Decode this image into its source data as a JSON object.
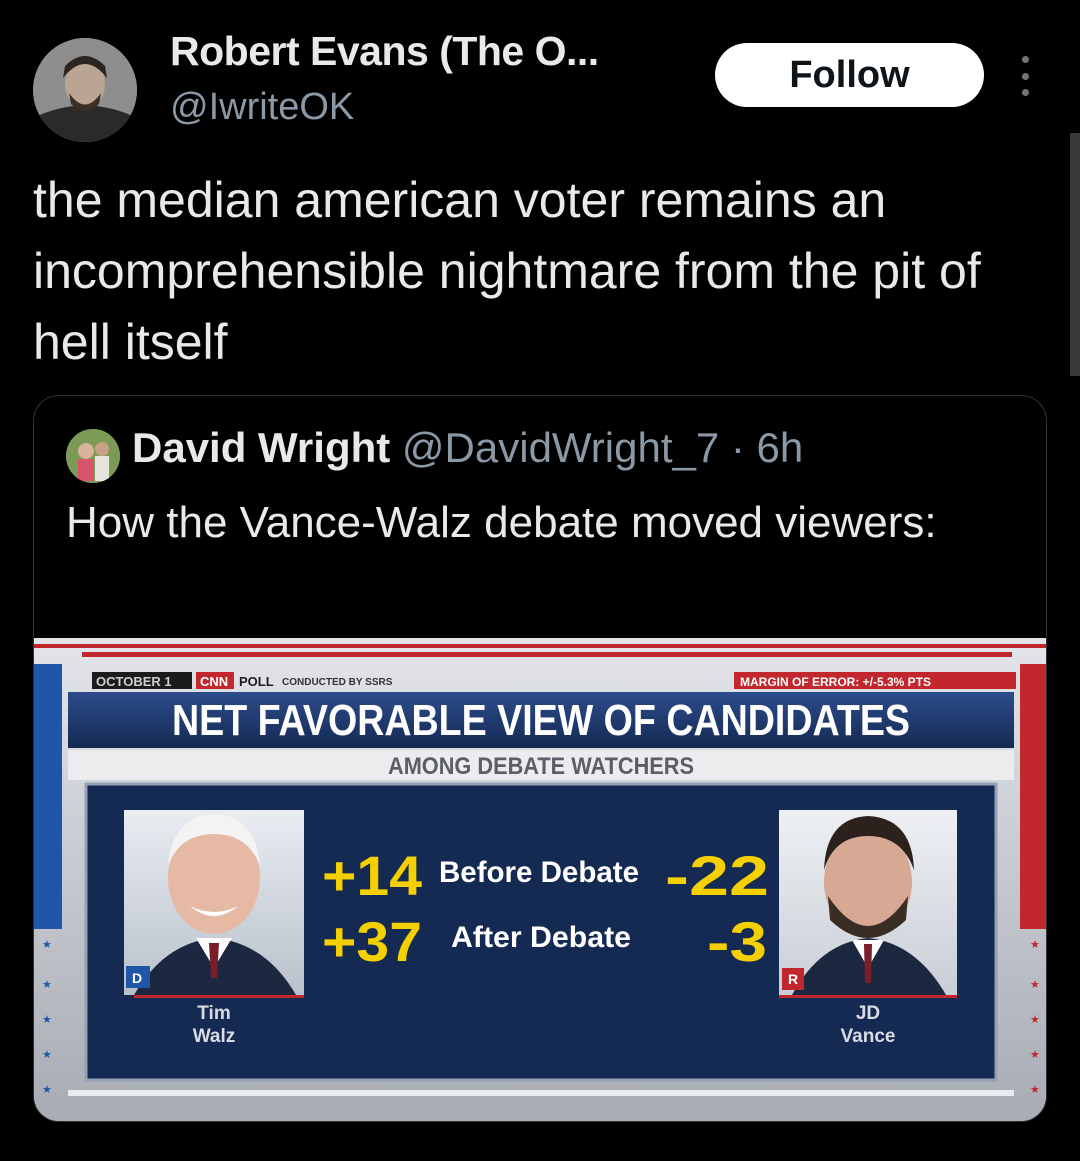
{
  "tweet": {
    "author_name": "Robert Evans (The O...",
    "author_handle": "@IwriteOK",
    "follow_label": "Follow",
    "text": "the median american voter remains an incomprehensible nightmare from the pit of hell itself"
  },
  "quoted_tweet": {
    "author_name": "David Wright",
    "meta": "@DavidWright_7 · 6h",
    "text": "How the Vance-Walz debate moved viewers:"
  },
  "graphic": {
    "date_label": "OCTOBER 1",
    "network": "CNN",
    "poll_label": "POLL",
    "conducted_by": "CONDUCTED BY SSRS",
    "margin_of_error": "MARGIN OF ERROR: +/-5.3% PTS",
    "title": "NET FAVORABLE VIEW OF CANDIDATES",
    "subtitle": "AMONG DEBATE WATCHERS",
    "rows": [
      {
        "label": "Before Debate",
        "left_value": "+14",
        "right_value": "-22"
      },
      {
        "label": "After Debate",
        "left_value": "+37",
        "right_value": "-3"
      }
    ],
    "left_candidate": {
      "first": "Tim",
      "last": "Walz",
      "party": "D"
    },
    "right_candidate": {
      "first": "JD",
      "last": "Vance",
      "party": "R"
    },
    "colors": {
      "navy": "#152a52",
      "red": "#c1272d",
      "blue": "#1f56a8",
      "yellow": "#f5d000"
    }
  }
}
